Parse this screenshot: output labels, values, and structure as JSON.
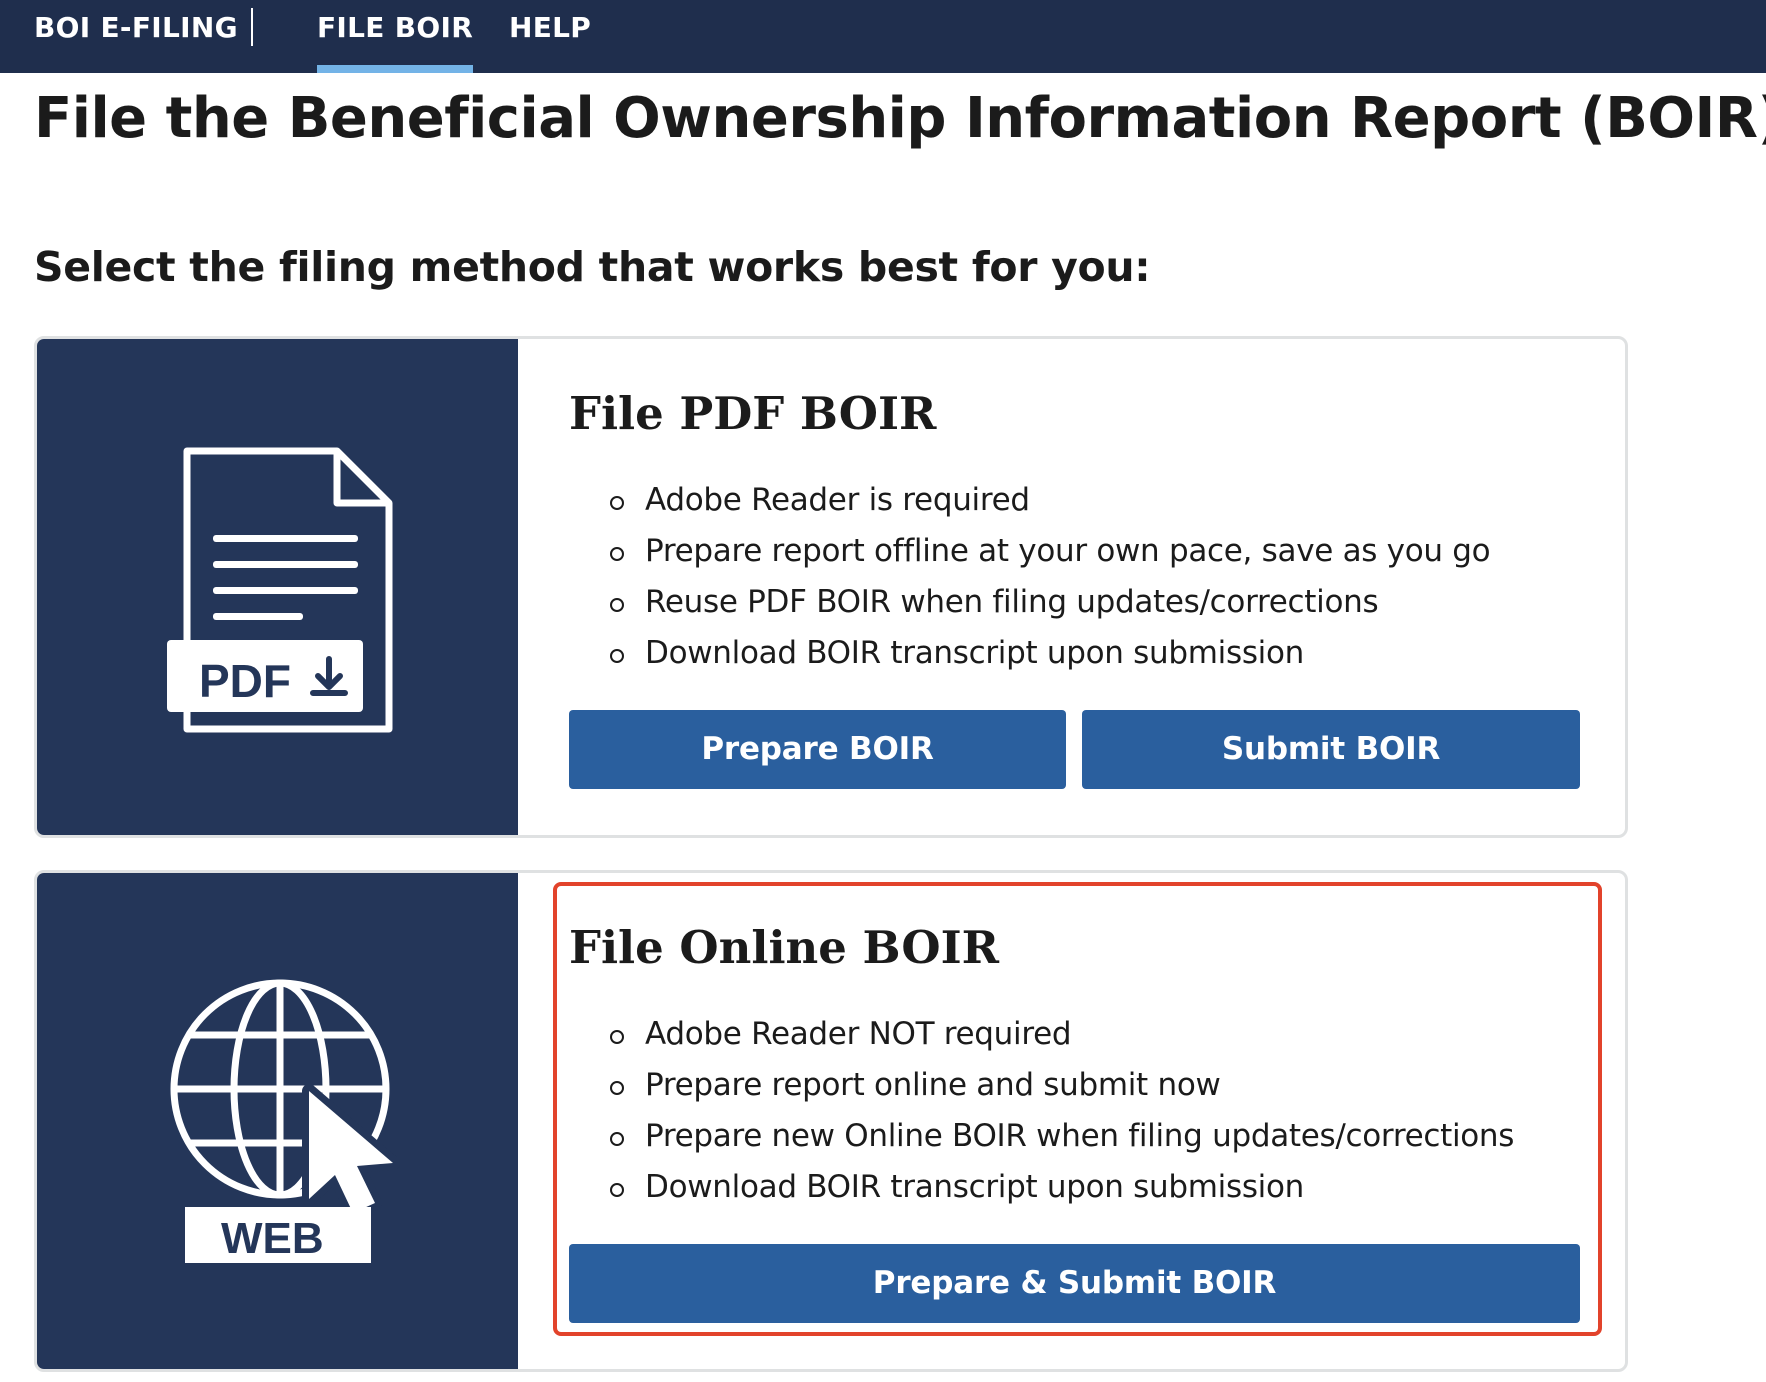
{
  "nav": {
    "brand": "BOI E-FILING",
    "items": [
      {
        "label": "FILE BOIR",
        "active": true
      },
      {
        "label": "HELP",
        "active": false
      }
    ]
  },
  "page": {
    "title": "File the Beneficial Ownership Information Report (BOIR)",
    "subtitle": "Select the filing method that works best for you:"
  },
  "cards": [
    {
      "id": "pdf",
      "icon": "pdf-download-icon",
      "icon_text": "PDF",
      "heading": "File PDF BOIR",
      "bullets": [
        "Adobe Reader is required",
        "Prepare report offline at your own pace, save as you go",
        "Reuse PDF BOIR when filing updates/corrections",
        "Download BOIR transcript upon submission"
      ],
      "buttons": [
        "Prepare BOIR",
        "Submit BOIR"
      ]
    },
    {
      "id": "online",
      "icon": "web-globe-icon",
      "icon_text": "WEB",
      "heading": "File Online BOIR",
      "bullets": [
        "Adobe Reader NOT required",
        "Prepare report online and submit now",
        "Prepare new Online BOIR when filing updates/corrections",
        "Download BOIR transcript upon submission"
      ],
      "buttons": [
        "Prepare & Submit BOIR"
      ]
    }
  ],
  "colors": {
    "nav_bg": "#1f2e4d",
    "card_media_bg": "#243659",
    "button_bg": "#2a5f9e",
    "active_underline": "#73b3e7",
    "highlight_border": "#e2432b"
  }
}
